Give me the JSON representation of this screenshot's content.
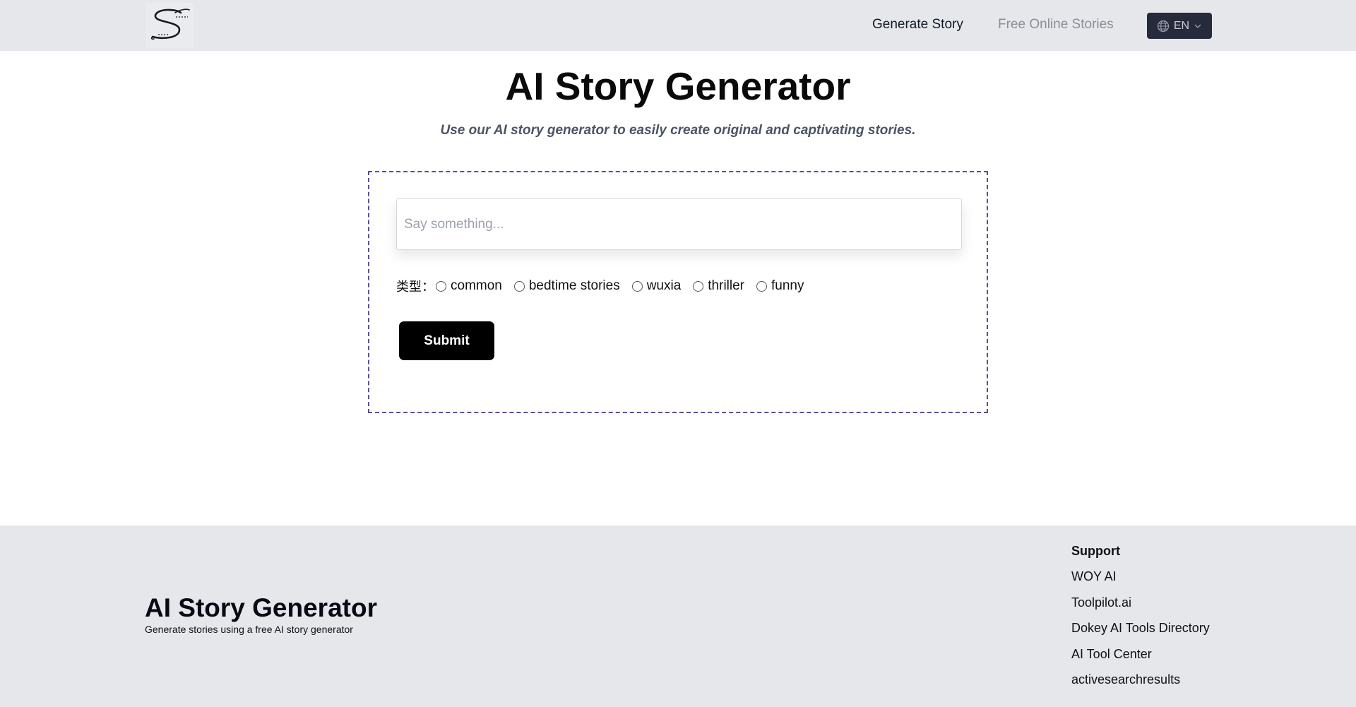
{
  "header": {
    "logo_icon": "s-script-logo",
    "nav": [
      {
        "label": "Generate Story",
        "color": "#111827"
      },
      {
        "label": "Free Online Stories",
        "color": "#8a8f99"
      }
    ],
    "language": {
      "label": "EN",
      "icon": "globe-icon",
      "caret_icon": "chevron-down-icon"
    }
  },
  "main": {
    "title": "AI Story Generator",
    "subtitle": "Use our AI story generator to easily create original and captivating stories.",
    "form": {
      "input_placeholder": "Say something...",
      "input_value": "",
      "type_label": "类型：",
      "types": [
        "common",
        "bedtime stories",
        "wuxia",
        "thriller",
        "funny"
      ],
      "selected_type": null,
      "submit_label": "Submit",
      "border_color": "#5b4f96"
    }
  },
  "footer": {
    "title": "AI Story Generator",
    "tagline": "Generate stories using a free AI story generator",
    "support": {
      "heading": "Support",
      "links": [
        "WOY AI",
        "Toolpilot.ai",
        "Dokey AI Tools Directory",
        "AI Tool Center",
        "activesearchresults"
      ]
    }
  },
  "colors": {
    "header_bg": "#e5e7eb",
    "footer_bg": "#e5e7eb",
    "lang_button_bg": "#272a3a",
    "submit_bg": "#000000"
  }
}
